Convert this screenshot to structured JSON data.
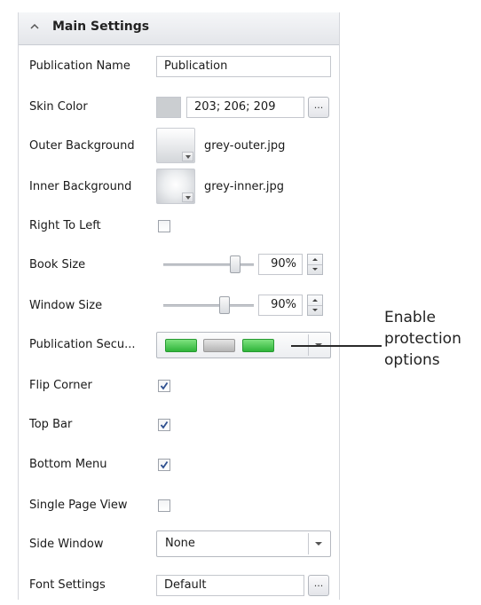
{
  "header": {
    "title": "Main Settings",
    "icon": "chevron-up-icon"
  },
  "rows": {
    "publication_name": {
      "label": "Publication Name",
      "value": "Publication"
    },
    "skin_color": {
      "label": "Skin Color",
      "value": "203; 206; 209",
      "swatch": "#cbced1",
      "button": "..."
    },
    "outer_background": {
      "label": "Outer Background",
      "file": "grey-outer.jpg"
    },
    "inner_background": {
      "label": "Inner Background",
      "file": "grey-inner.jpg"
    },
    "right_to_left": {
      "label": "Right To Left",
      "checked": false
    },
    "book_size": {
      "label": "Book Size",
      "value": "90%",
      "level": 0.9
    },
    "window_size": {
      "label": "Window Size",
      "value": "90%",
      "level": 0.9
    },
    "publication_security": {
      "label": "Publication Secu...",
      "blocks": [
        "green",
        "grey",
        "green"
      ]
    },
    "flip_corner": {
      "label": "Flip Corner",
      "checked": true
    },
    "top_bar": {
      "label": "Top Bar",
      "checked": true
    },
    "bottom_menu": {
      "label": "Bottom Menu",
      "checked": true
    },
    "single_page_view": {
      "label": "Single Page View",
      "checked": false
    },
    "side_window": {
      "label": "Side Window",
      "value": "None"
    },
    "font_settings": {
      "label": "Font Settings",
      "value": "Default",
      "button": "..."
    }
  },
  "callout": {
    "lines": [
      "Enable",
      "protection",
      "options"
    ]
  },
  "colors": {
    "accent_green": "#2fb43a",
    "check": "#2d4f8f"
  }
}
